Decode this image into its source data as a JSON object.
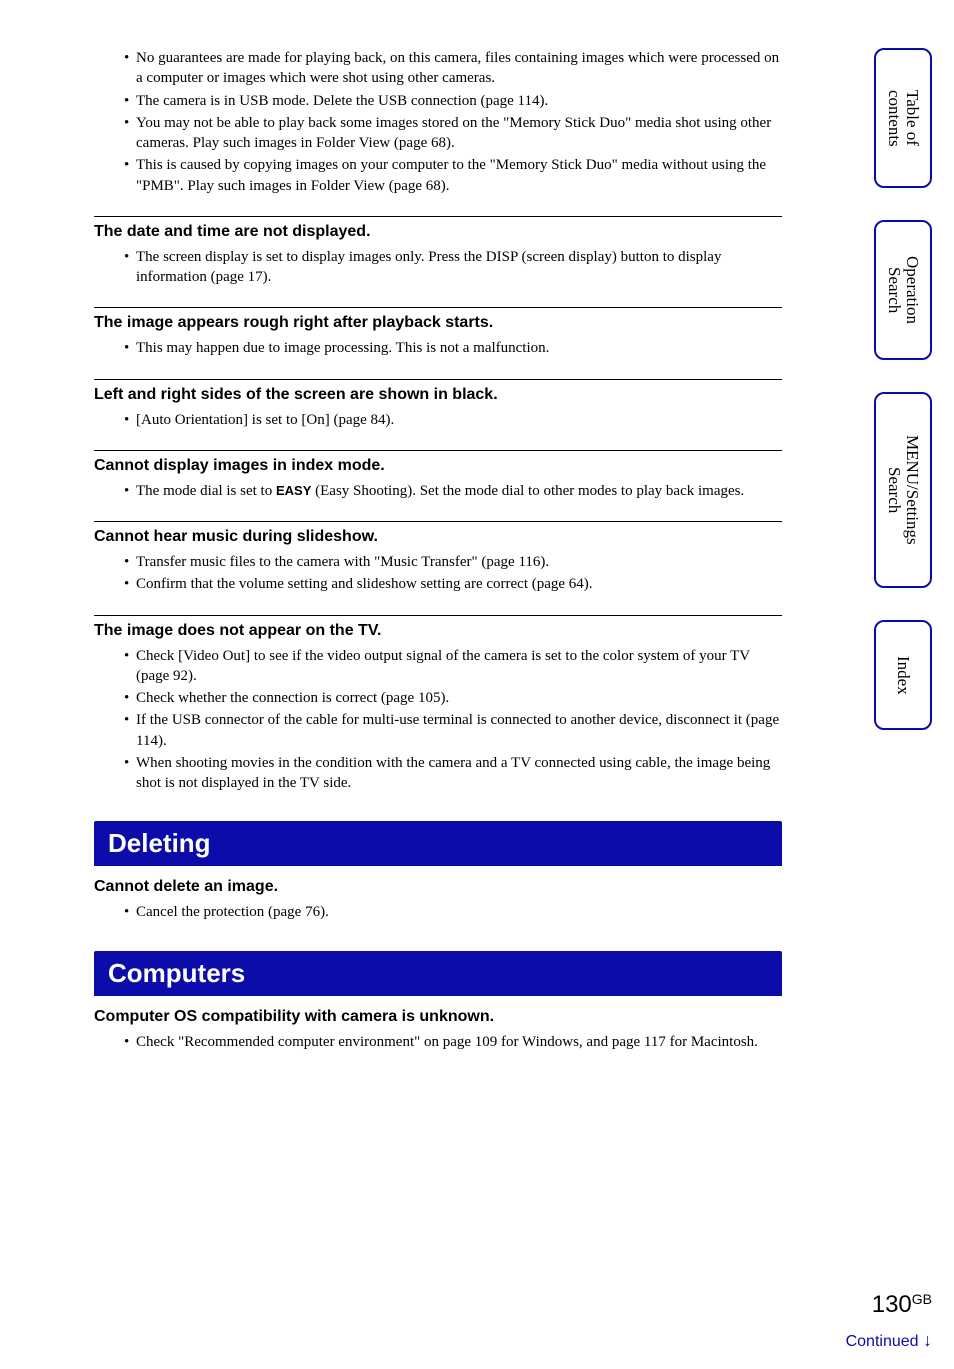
{
  "intro_bullets": [
    "No guarantees are made for playing back, on this camera, files containing images which were processed on a computer or images which were shot using other cameras.",
    "The camera is in USB mode. Delete the USB connection (page 114).",
    "You may not be able to play back some images stored on the \"Memory Stick Duo\" media shot using other cameras. Play such images in Folder View (page 68).",
    "This is caused by copying images on your computer to the \"Memory Stick Duo\" media without using the \"PMB\". Play such images in Folder View (page 68)."
  ],
  "issues": [
    {
      "title": "The date and time are not displayed.",
      "bullets": [
        "The screen display is set to display images only. Press the DISP (screen display) button to display information (page 17)."
      ]
    },
    {
      "title": "The image appears rough right after playback starts.",
      "bullets": [
        "This may happen due to image processing. This is not a malfunction."
      ]
    },
    {
      "title": "Left and right sides of the screen are shown in black.",
      "bullets": [
        "[Auto Orientation] is set to [On] (page 84)."
      ]
    },
    {
      "title": "Cannot display images in index mode.",
      "bullets": [
        "__EASY__"
      ]
    },
    {
      "title": "Cannot hear music during slideshow.",
      "bullets": [
        "Transfer music files to the camera with \"Music Transfer\" (page 116).",
        "Confirm that the volume setting and slideshow setting are correct (page 64)."
      ]
    },
    {
      "title": "The image does not appear on the TV.",
      "bullets": [
        "Check [Video Out] to see if the video output signal of the camera is set to the color system of your TV (page 92).",
        "Check whether the connection is correct (page 105).",
        "If the USB connector of the cable for multi-use terminal is connected to another device, disconnect it (page 114).",
        "When shooting movies in the condition with the camera and a TV connected using cable, the image being shot is not displayed in the TV side."
      ]
    }
  ],
  "easy_bullet": {
    "before": "The mode dial is set to ",
    "easy": "EASY",
    "after": " (Easy Shooting). Set the mode dial to other modes to play back images."
  },
  "sections": [
    {
      "banner": "Deleting",
      "title": "Cannot delete an image.",
      "bullets": [
        "Cancel the protection (page 76)."
      ]
    },
    {
      "banner": "Computers",
      "title": "Computer OS compatibility with camera is unknown.",
      "bullets": [
        "Check \"Recommended computer environment\" on page 109 for Windows, and page 117 for Macintosh."
      ]
    }
  ],
  "tabs": {
    "toc": "Table of\ncontents",
    "operation": "Operation\nSearch",
    "menu": "MENU/Settings\nSearch",
    "index": "Index"
  },
  "page": {
    "num": "130",
    "suffix": "GB"
  },
  "continued": "Continued",
  "arrow": "↓"
}
